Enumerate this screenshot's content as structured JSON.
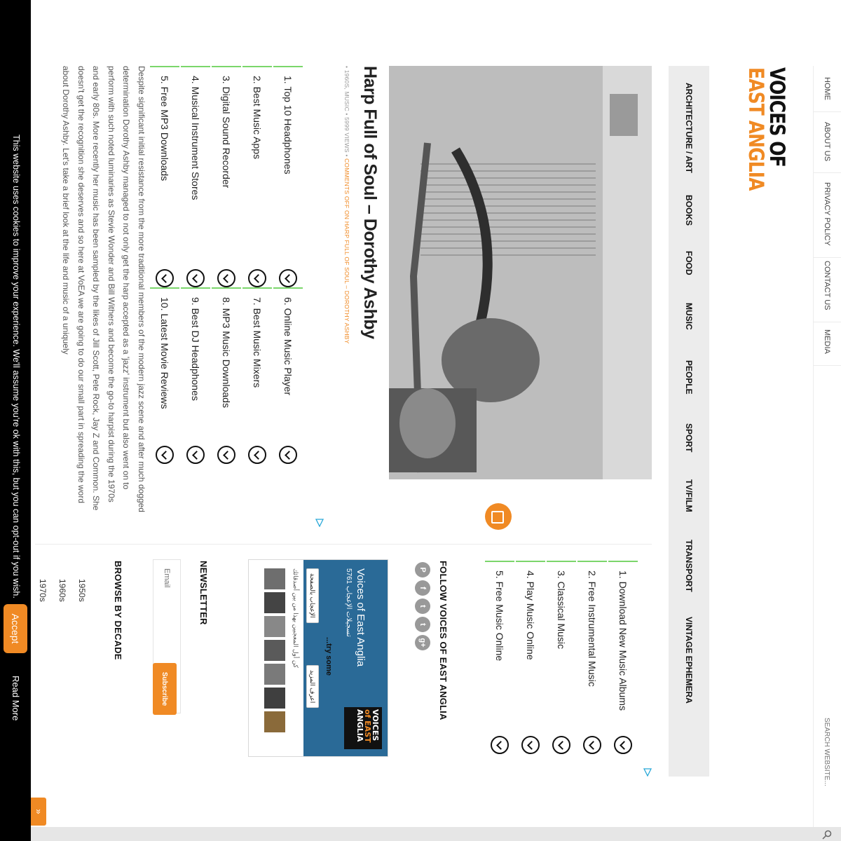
{
  "top_nav": {
    "items": [
      "HOME",
      "ABOUT US",
      "PRIVACY POLICY",
      "CONTACT US",
      "MEDIA"
    ],
    "search_placeholder": "SEARCH WEBSITE..."
  },
  "logo": {
    "line1": "VOICES OF",
    "line2": "EAST ANGLIA"
  },
  "category_nav": [
    "ARCHITECTURE / ART",
    "BOOKS",
    "FOOD",
    "MUSIC",
    "PEOPLE",
    "SPORT",
    "TV/FILM",
    "TRANSPORT",
    "VINTAGE EPHEMERA"
  ],
  "ad_top": {
    "items": [
      "1. Download New Music Albums",
      "2. Free Instrumental Music",
      "3. Classical Music",
      "4. Play Music Online",
      "5. Free Music Online"
    ]
  },
  "post": {
    "title": "Harp Full of Soul – Dorothy Ashby",
    "meta_prefix": "• 1960S, MUSIC • 5999 VIEWS • ",
    "meta_comments": "COMMENTS OFF ON HARP FULL OF SOUL – DOROTHY ASHBY",
    "body": "Despite significant initial resistance from the more traditional members of the modern jazz scene and after much dogged determination Dorothy Ashby managed to not only get the harp accepted as a 'jazz' instrument but also went on to perform with such noted luminaries as Stevie Wonder and Bill Withers and become the go-to harpist during the 1970s and early 80s. More recently her music has been sampled by the likes of Jill Scott, Pete Rock, Jay Z and Common. She doesn't get the recognition she deserves and so here at VoEA we are going to do our small part in spreading the word about Dorothy Ashby. Let's take a brief look at the life and music of a uniquely"
  },
  "ad_inline": {
    "left": [
      "1. Top 10 Headphones",
      "2. Best Music Apps",
      "3. Digital Sound Recorder",
      "4. Musical Instrument Stores",
      "5. Free MP3 Downloads"
    ],
    "right": [
      "6. Online Music Player",
      "7. Best Music Mixers",
      "8. MP3 Music Downloads",
      "9. Best DJ Headphones",
      "10. Latest Movie Reviews"
    ]
  },
  "sidebar": {
    "follow_heading": "FOLLOW VOICES OF EAST ANGLIA",
    "social_icons": [
      {
        "name": "pinterest-icon",
        "glyph": "P"
      },
      {
        "name": "facebook-icon",
        "glyph": "f"
      },
      {
        "name": "twitter-icon",
        "glyph": "t"
      },
      {
        "name": "tumblr-icon",
        "glyph": "t"
      },
      {
        "name": "googleplus-icon",
        "glyph": "g+"
      }
    ],
    "fb_widget": {
      "page_name": "Voices of East Anglia",
      "likes": "5761 تسجيلات الإعجاب",
      "cta": "...try some",
      "like_button": "الإعجاب بالصفحة",
      "learn_more": "اعرف المزيد",
      "friends_text": "كن أول المعجبين بهذا من بين أصدقائك",
      "logo_line1": "VOICES",
      "logo_line2": "of EAST",
      "logo_line3": "ANGLIA"
    },
    "newsletter_heading": "NEWSLETTER",
    "email_placeholder": "Email",
    "subscribe_label": "Subscribe",
    "decade_heading": "BROWSE BY DECADE",
    "decades": [
      "1950s",
      "1960s",
      "1970s"
    ]
  },
  "cookie_bar": {
    "text": "This website uses cookies to improve your experience. We'll assume you're ok with this, but you can opt-out if you wish.",
    "accept": "Accept",
    "read_more": "Read More"
  },
  "scroll_button": "»",
  "colors": {
    "accent": "#f08a24",
    "ad_border": "#7bd66b",
    "nav_bg": "#ececec"
  }
}
